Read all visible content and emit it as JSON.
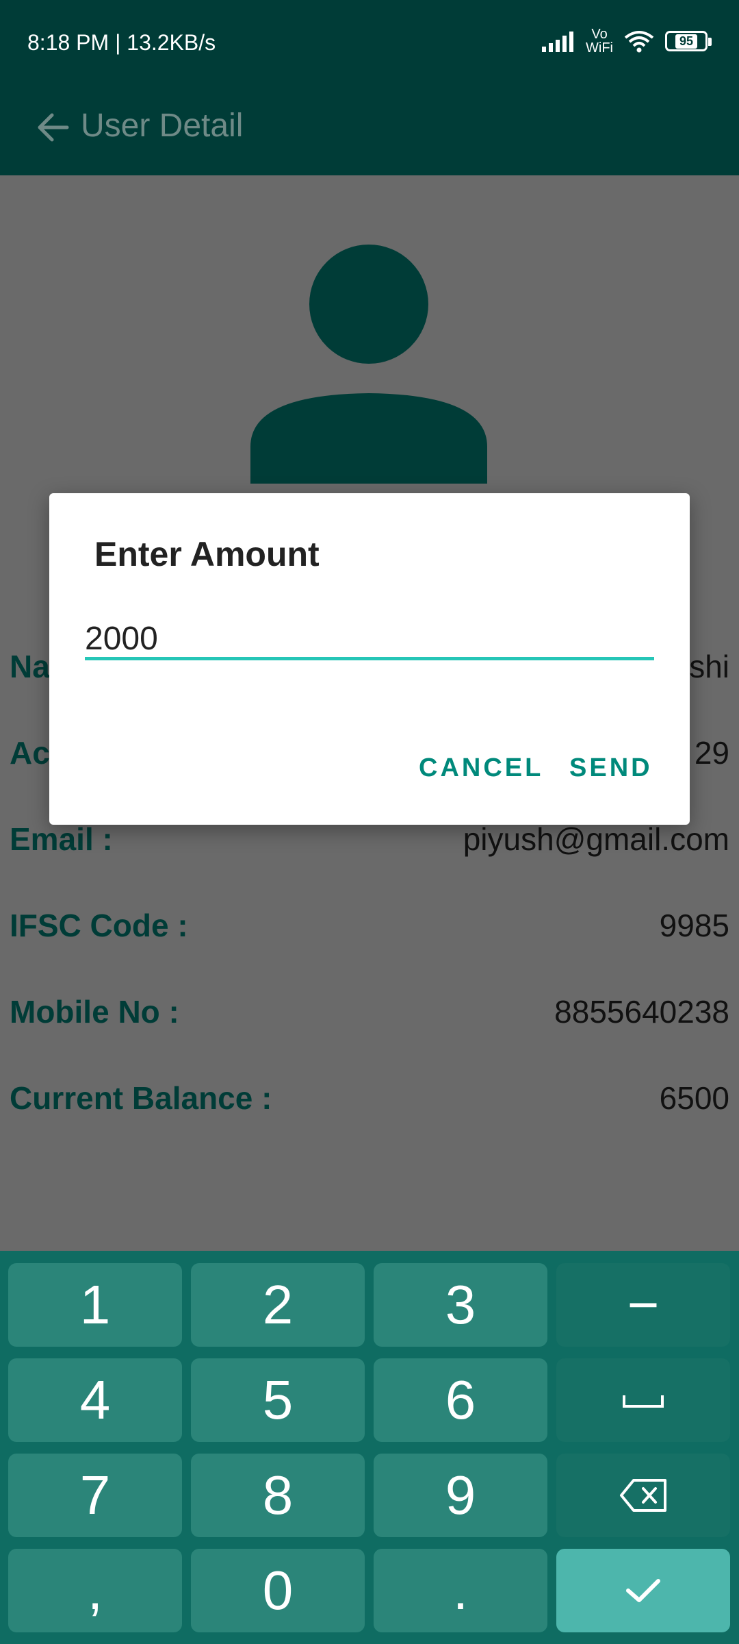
{
  "status_bar": {
    "time_speed": "8:18 PM | 13.2KB/s",
    "vowifi_top": "Vo",
    "vowifi_bottom": "WiFi",
    "battery": "95"
  },
  "toolbar": {
    "title": "User Detail"
  },
  "details": [
    {
      "label": "Na",
      "value": "shi"
    },
    {
      "label": "Ac",
      "value": "29"
    },
    {
      "label": "Email :",
      "value": "piyush@gmail.com"
    },
    {
      "label": "IFSC Code :",
      "value": "9985"
    },
    {
      "label": "Mobile No :",
      "value": "8855640238"
    },
    {
      "label": "Current Balance :",
      "value": "6500"
    }
  ],
  "dialog": {
    "title": "Enter Amount",
    "input_value": "2000",
    "cancel_label": "CANCEL",
    "send_label": "SEND"
  },
  "keyboard": {
    "keys": [
      "1",
      "2",
      "3",
      "−",
      "4",
      "5",
      "6",
      "␣",
      "7",
      "8",
      "9",
      "backspace",
      ",",
      "0",
      ".",
      "done"
    ]
  },
  "colors": {
    "primary_dark": "#003c37",
    "accent": "#26c6b7",
    "button_text": "#00897b",
    "keyboard_bg": "#0f6c62"
  }
}
